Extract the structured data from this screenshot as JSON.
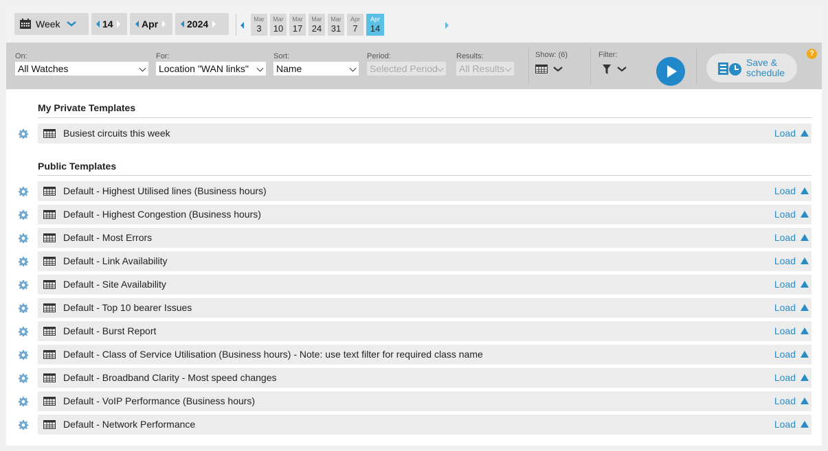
{
  "datebar": {
    "period_label": "Week",
    "day": "14",
    "month": "Apr",
    "year": "2024",
    "weeks": [
      {
        "month": "Mar",
        "day": "3",
        "selected": false
      },
      {
        "month": "Mar",
        "day": "10",
        "selected": false
      },
      {
        "month": "Mar",
        "day": "17",
        "selected": false
      },
      {
        "month": "Mar",
        "day": "24",
        "selected": false
      },
      {
        "month": "Mar",
        "day": "31",
        "selected": false
      },
      {
        "month": "Apr",
        "day": "7",
        "selected": false
      },
      {
        "month": "Apr",
        "day": "14",
        "selected": true
      }
    ]
  },
  "toolbar": {
    "on": {
      "label": "On:",
      "value": "All Watches"
    },
    "for": {
      "label": "For:",
      "value": "Location \"WAN links\""
    },
    "sort": {
      "label": "Sort:",
      "value": "Name"
    },
    "period": {
      "label": "Period:",
      "value": "Selected Period"
    },
    "results": {
      "label": "Results:",
      "value": "All Results"
    },
    "show": {
      "label": "Show: (6)"
    },
    "filter": {
      "label": "Filter:"
    },
    "save_label_line1": "Save &",
    "save_label_line2": "schedule",
    "help": "?"
  },
  "private_section": {
    "title": "My Private Templates",
    "items": [
      {
        "name": "Busiest circuits this week",
        "action": "Load"
      }
    ]
  },
  "public_section": {
    "title": "Public Templates",
    "items": [
      {
        "name": "Default - Highest Utilised lines (Business hours)",
        "action": "Load"
      },
      {
        "name": "Default - Highest Congestion (Business hours)",
        "action": "Load"
      },
      {
        "name": "Default - Most Errors",
        "action": "Load"
      },
      {
        "name": "Default - Link Availability",
        "action": "Load"
      },
      {
        "name": "Default - Site Availability",
        "action": "Load"
      },
      {
        "name": "Default - Top 10 bearer Issues",
        "action": "Load"
      },
      {
        "name": "Default - Burst Report",
        "action": "Load"
      },
      {
        "name": "Default - Class of Service Utilisation (Business hours) - Note: use text filter for required class name",
        "action": "Load"
      },
      {
        "name": "Default - Broadband Clarity - Most speed changes",
        "action": "Load"
      },
      {
        "name": "Default - VoIP Performance (Business hours)",
        "action": "Load"
      },
      {
        "name": "Default - Network Performance",
        "action": "Load"
      }
    ]
  },
  "colors": {
    "accent": "#2a8cc4",
    "selected_week": "#5bc0e6",
    "help": "#f0a81c"
  }
}
